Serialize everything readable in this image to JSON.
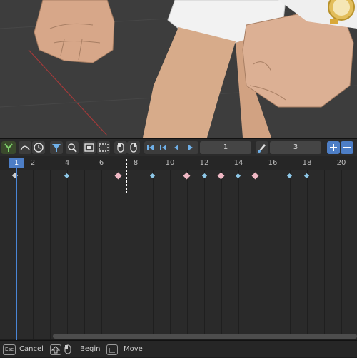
{
  "toolbar": {
    "frame_field": "1",
    "step_field": "3"
  },
  "ruler": {
    "current_frame": "1",
    "ticks": [
      "2",
      "4",
      "6",
      "8",
      "10",
      "12",
      "14",
      "16",
      "18",
      "20"
    ]
  },
  "statusbar": {
    "cancel_key": "Esc",
    "cancel_label": "Cancel",
    "begin_label": "Begin",
    "move_label": "Move"
  },
  "colors": {
    "viewport_bg": "#3d3d3d",
    "playhead": "#4a86d6",
    "key_selected": "#f0b8c4",
    "key_normal": "#8ec8e8"
  }
}
